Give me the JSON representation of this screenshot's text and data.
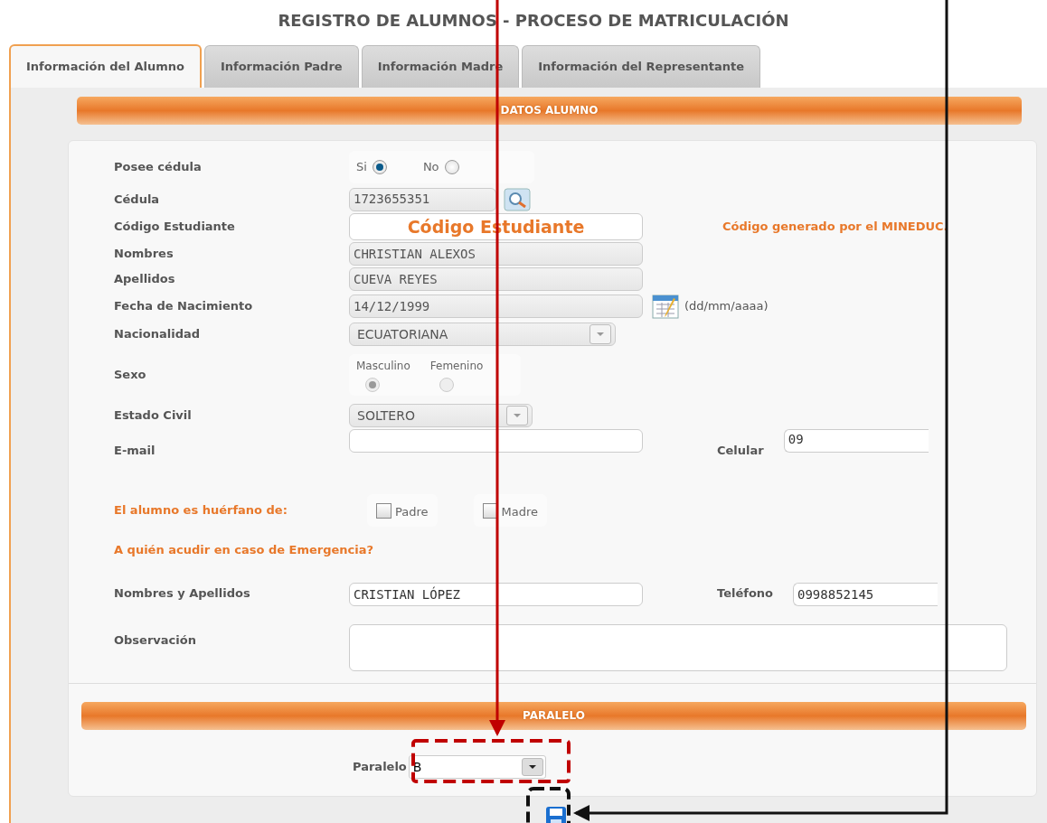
{
  "title": "REGISTRO DE ALUMNOS - PROCESO DE MATRICULACIÓN",
  "tabs": [
    {
      "label": "Información del Alumno",
      "selected": true
    },
    {
      "label": "Información Padre",
      "selected": false
    },
    {
      "label": "Información Madre",
      "selected": false
    },
    {
      "label": "Información del Representante",
      "selected": false
    }
  ],
  "section_header": "DATOS ALUMNO",
  "rows": [
    {
      "kind": "radio",
      "label": "Posee cédula",
      "options": [
        {
          "label": "Si",
          "selected": true
        },
        {
          "label": "No",
          "selected": false
        }
      ]
    },
    {
      "kind": "search",
      "label": "Cédula",
      "value": "1723655351"
    },
    {
      "kind": "code",
      "label": "Código Estudiante",
      "value": "Código Estudiante",
      "note": "Código generado por el MINEDUC."
    },
    {
      "kind": "readonly",
      "label": "Nombres",
      "value": "CHRISTIAN ALEXOS"
    },
    {
      "kind": "readonly",
      "label": "Apellidos",
      "value": "CUEVA REYES"
    },
    {
      "kind": "date",
      "label": "Fecha de Nacimiento",
      "value": "14/12/1999",
      "hint": "(dd/mm/aaaa)"
    },
    {
      "kind": "select",
      "label": "Nacionalidad",
      "value": "ECUATORIANA",
      "wide": true
    },
    {
      "kind": "stacked",
      "label": "Sexo",
      "disabled": true,
      "options": [
        {
          "label": "Masculino",
          "selected": true
        },
        {
          "label": "Femenino",
          "selected": false
        }
      ]
    },
    {
      "kind": "select",
      "label": "Estado Civil",
      "value": "SOLTERO",
      "wide": false
    },
    {
      "kind": "pair",
      "label": "E-mail",
      "side_label": "Celular",
      "side_value": "09"
    },
    {
      "kind": "checks",
      "label": "El alumno es huérfano de:",
      "options": [
        {
          "label": "Padre",
          "checked": false
        },
        {
          "label": "Madre",
          "checked": false
        }
      ]
    },
    {
      "kind": "heading",
      "label": "A quién acudir en caso de Emergencia?"
    },
    {
      "kind": "pair",
      "label": "Nombres y Apellidos",
      "value": "CRISTIAN LÓPEZ",
      "side_label": "Teléfono",
      "side_value": "0998852145"
    },
    {
      "kind": "textarea",
      "label": "Observación"
    }
  ],
  "paralelo": {
    "header": "PARALELO",
    "label": "Paralelo",
    "value": "B"
  }
}
